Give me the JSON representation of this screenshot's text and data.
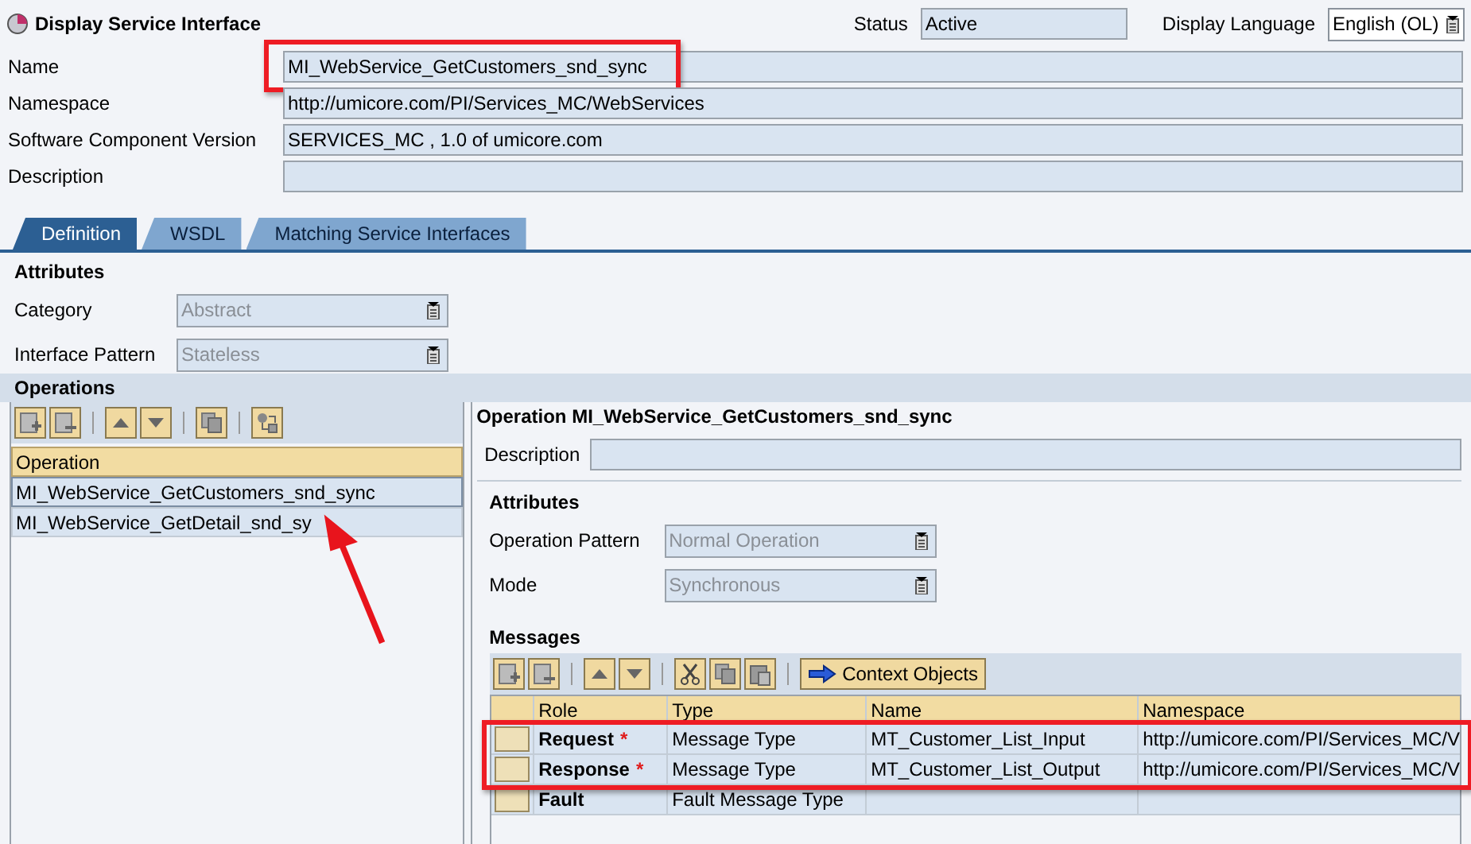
{
  "window": {
    "title": "Display Service Interface"
  },
  "status": {
    "label": "Status",
    "value": "Active"
  },
  "display_language": {
    "label": "Display Language",
    "value": "English (OL)"
  },
  "fields": [
    {
      "label": "Name",
      "value": "MI_WebService_GetCustomers_snd_sync",
      "highlighted": true
    },
    {
      "label": "Namespace",
      "value": "http://umicore.com/PI/Services_MC/WebServices",
      "highlighted": false
    },
    {
      "label": "Software Component Version",
      "value": "SERVICES_MC , 1.0 of umicore.com",
      "highlighted": false
    },
    {
      "label": "Description",
      "highlighted": false
    }
  ],
  "tabs": [
    {
      "label": "Definition",
      "selected": true
    },
    {
      "label": "WSDL",
      "selected": false
    },
    {
      "label": "Matching Service Interfaces",
      "selected": false
    }
  ],
  "attributes": {
    "title": "Attributes",
    "fields": [
      {
        "label": "Category",
        "value": "Abstract",
        "disabled": true
      },
      {
        "label": "Interface Pattern",
        "value": "Stateless",
        "disabled": true
      }
    ]
  },
  "operations": {
    "title": "Operations",
    "column": "Operation",
    "rows": [
      {
        "name": "MI_WebService_GetCustomers_snd_sync",
        "selected": true
      },
      {
        "name": "MI_WebService_GetDetail_snd_sy",
        "selected": false
      }
    ]
  },
  "operation_detail": {
    "title": "Operation MI_WebService_GetCustomers_snd_sync",
    "description_label": "Description",
    "attributes_title": "Attributes",
    "fields": [
      {
        "label": "Operation Pattern",
        "value": "Normal Operation",
        "disabled": true
      },
      {
        "label": "Mode",
        "value": "Synchronous",
        "disabled": true
      }
    ],
    "messages": {
      "title": "Messages",
      "context_button": "Context Objects",
      "columns": [
        "Role",
        "Type",
        "Name",
        "Namespace"
      ],
      "rows": [
        {
          "role": "Request",
          "required_mark": "*",
          "type": "Message Type",
          "name": "MT_Customer_List_Input",
          "namespace": "http://umicore.com/PI/Services_MC/V",
          "highlighted": true
        },
        {
          "role": "Response",
          "required_mark": "*",
          "type": "Message Type",
          "name": "MT_Customer_List_Output",
          "namespace": "http://umicore.com/PI/Services_MC/V",
          "highlighted": true
        },
        {
          "role": "Fault",
          "type": "Fault Message Type",
          "highlighted": false
        }
      ]
    }
  }
}
